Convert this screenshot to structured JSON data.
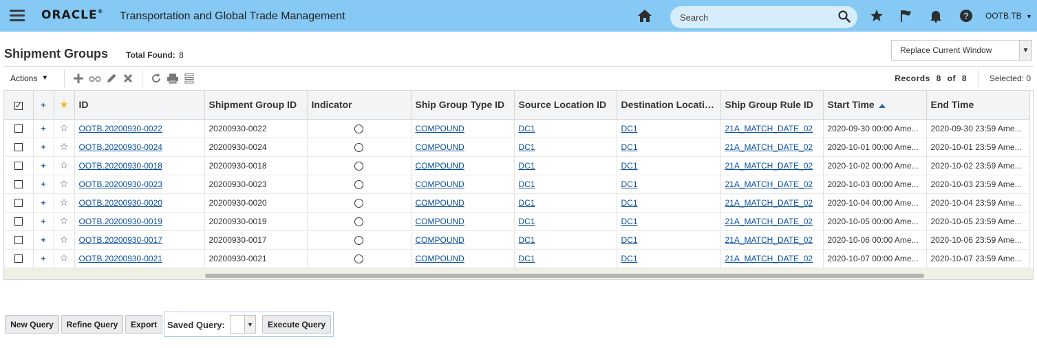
{
  "header": {
    "brand": "ORACLE",
    "app_title": "Transportation and Global Trade Management",
    "search_placeholder": "Search",
    "user": "OOTB.TB"
  },
  "page": {
    "title": "Shipment Groups",
    "total_found_label": "Total Found:",
    "total_found": "8",
    "window_mode": "Replace Current Window"
  },
  "toolbar": {
    "actions_label": "Actions",
    "records_label": "Records",
    "records_count": "8",
    "records_of": "of",
    "records_total": "8",
    "selected_label": "Selected:",
    "selected_count": "0"
  },
  "table": {
    "columns": [
      "ID",
      "Shipment Group ID",
      "Indicator",
      "Ship Group Type ID",
      "Source Location ID",
      "Destination Locatio...",
      "Ship Group Rule ID",
      "Start Time",
      "End Time"
    ],
    "sort_column": "Start Time",
    "sort_direction": "ascending",
    "rows": [
      {
        "id": "OOTB.20200930-0022",
        "group_id": "20200930-0022",
        "type": "COMPOUND",
        "source": "DC1",
        "dest": "DC1",
        "rule": "21A_MATCH_DATE_02",
        "start": "2020-09-30 00:00 Ame...",
        "end": "2020-09-30 23:59 Ame..."
      },
      {
        "id": "OOTB.20200930-0024",
        "group_id": "20200930-0024",
        "type": "COMPOUND",
        "source": "DC1",
        "dest": "DC1",
        "rule": "21A_MATCH_DATE_02",
        "start": "2020-10-01 00:00 Ame...",
        "end": "2020-10-01 23:59 Ame..."
      },
      {
        "id": "OOTB.20200930-0018",
        "group_id": "20200930-0018",
        "type": "COMPOUND",
        "source": "DC1",
        "dest": "DC1",
        "rule": "21A_MATCH_DATE_02",
        "start": "2020-10-02 00:00 Ame...",
        "end": "2020-10-02 23:59 Ame..."
      },
      {
        "id": "OOTB.20200930-0023",
        "group_id": "20200930-0023",
        "type": "COMPOUND",
        "source": "DC1",
        "dest": "DC1",
        "rule": "21A_MATCH_DATE_02",
        "start": "2020-10-03 00:00 Ame...",
        "end": "2020-10-03 23:59 Ame..."
      },
      {
        "id": "OOTB.20200930-0020",
        "group_id": "20200930-0020",
        "type": "COMPOUND",
        "source": "DC1",
        "dest": "DC1",
        "rule": "21A_MATCH_DATE_02",
        "start": "2020-10-04 00:00 Ame...",
        "end": "2020-10-04 23:59 Ame..."
      },
      {
        "id": "OOTB.20200930-0019",
        "group_id": "20200930-0019",
        "type": "COMPOUND",
        "source": "DC1",
        "dest": "DC1",
        "rule": "21A_MATCH_DATE_02",
        "start": "2020-10-05 00:00 Ame...",
        "end": "2020-10-05 23:59 Ame..."
      },
      {
        "id": "OOTB.20200930-0017",
        "group_id": "20200930-0017",
        "type": "COMPOUND",
        "source": "DC1",
        "dest": "DC1",
        "rule": "21A_MATCH_DATE_02",
        "start": "2020-10-06 00:00 Ame...",
        "end": "2020-10-06 23:59 Ame..."
      },
      {
        "id": "OOTB.20200930-0021",
        "group_id": "20200930-0021",
        "type": "COMPOUND",
        "source": "DC1",
        "dest": "DC1",
        "rule": "21A_MATCH_DATE_02",
        "start": "2020-10-07 00:00 Ame...",
        "end": "2020-10-07 23:59 Ame..."
      }
    ]
  },
  "footer": {
    "new_query": "New Query",
    "refine_query": "Refine Query",
    "export": "Export",
    "saved_query_label": "Saved Query:",
    "saved_query_value": "",
    "execute_query": "Execute Query"
  },
  "icons": {
    "menu": "hamburger-menu-icon",
    "home": "home-icon",
    "search": "search-icon",
    "favorites": "star-icon",
    "flag": "flag-icon",
    "notifications": "bell-icon",
    "help": "help-icon",
    "toolbar": [
      "add-icon",
      "view-icon",
      "edit-icon",
      "delete-icon",
      "refresh-icon",
      "print-icon",
      "column-settings-icon"
    ]
  },
  "colors": {
    "header_bg": "#86c9f4",
    "link": "#0a4f9e",
    "favorite_star": "#f3b71c"
  }
}
